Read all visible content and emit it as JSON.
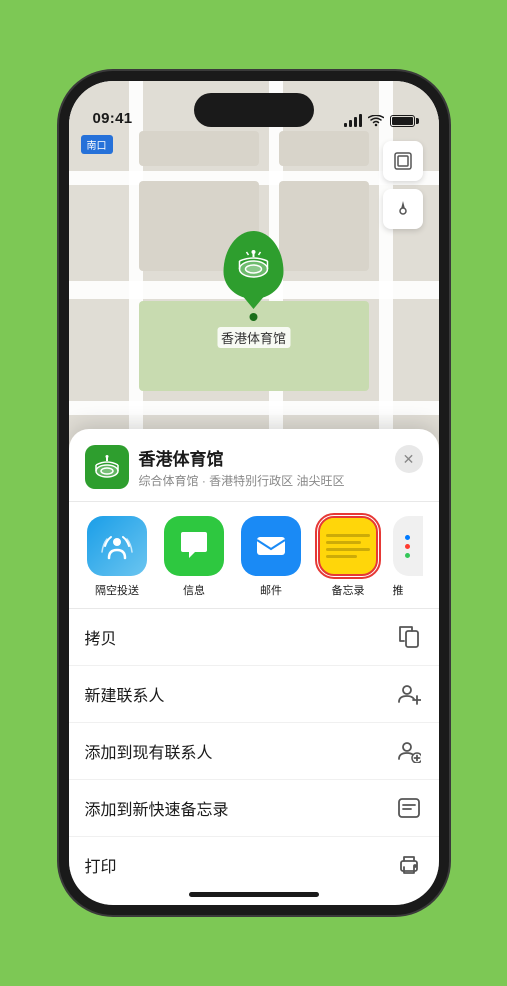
{
  "status_bar": {
    "time": "09:41",
    "location_arrow": "▲"
  },
  "map": {
    "label": "南口",
    "venue_pin_label": "香港体育馆"
  },
  "map_controls": {
    "layers_btn": "⊞",
    "location_btn": "➤"
  },
  "venue_card": {
    "name": "香港体育馆",
    "subtitle": "综合体育馆 · 香港特别行政区 油尖旺区",
    "close_label": "✕"
  },
  "share_items": [
    {
      "id": "airdrop",
      "label": "隔空投送",
      "type": "airdrop"
    },
    {
      "id": "messages",
      "label": "信息",
      "type": "messages"
    },
    {
      "id": "mail",
      "label": "邮件",
      "type": "mail"
    },
    {
      "id": "notes",
      "label": "备忘录",
      "type": "notes"
    },
    {
      "id": "more",
      "label": "推",
      "type": "more"
    }
  ],
  "action_items": [
    {
      "id": "copy",
      "label": "拷贝",
      "icon": "copy"
    },
    {
      "id": "new-contact",
      "label": "新建联系人",
      "icon": "person-add"
    },
    {
      "id": "add-contact",
      "label": "添加到现有联系人",
      "icon": "person-plus"
    },
    {
      "id": "add-note",
      "label": "添加到新快速备忘录",
      "icon": "note"
    },
    {
      "id": "print",
      "label": "打印",
      "icon": "print"
    }
  ]
}
